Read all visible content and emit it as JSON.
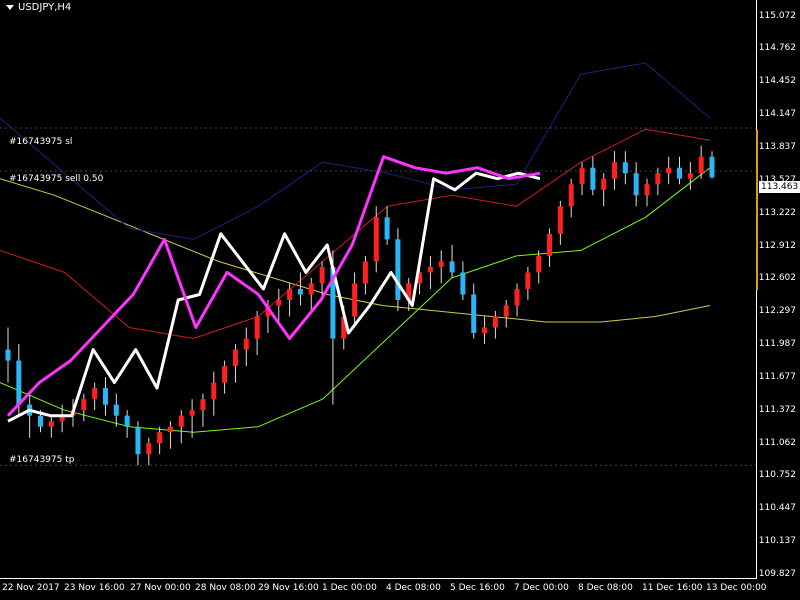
{
  "window": {
    "title": "USDJPY,H4",
    "menu_icon": "triangle-down-icon"
  },
  "orders": [
    {
      "label": "#16743975 sl",
      "price": 113.91
    },
    {
      "label": "#16743975 sell 0.50",
      "price": 113.52
    },
    {
      "label": "#16743975 tp",
      "price": 110.85
    }
  ],
  "current_price": {
    "label": "113.463",
    "value": 113.463
  },
  "price_axis": {
    "ticks": [
      "115.072",
      "114.762",
      "114.452",
      "114.147",
      "113.837",
      "113.527",
      "113.222",
      "112.912",
      "112.602",
      "112.297",
      "111.987",
      "111.677",
      "111.372",
      "111.062",
      "110.752",
      "110.447",
      "110.137",
      "109.827"
    ]
  },
  "time_axis": {
    "ticks": [
      "22 Nov 2017",
      "23 Nov 16:00",
      "27 Nov 00:00",
      "28 Nov 08:00",
      "29 Nov 16:00",
      "1 Dec 00:00",
      "4 Dec 08:00",
      "5 Dec 16:00",
      "7 Dec 00:00",
      "8 Dec 08:00",
      "11 Dec 16:00",
      "13 Dec 00:00"
    ]
  },
  "colors": {
    "bull": "#ff2020",
    "bear": "#29b6f6",
    "white_line": "#ffffff",
    "magenta_line": "#ff33ff",
    "ma_yellow": "#d4c84a",
    "ma_green": "#7cfc00",
    "band_red": "#c81e1e",
    "band_navy": "#1a237e",
    "cloud": "#3355ff"
  },
  "chart_data": {
    "type": "candlestick",
    "symbol": "USDJPY",
    "timeframe": "H4",
    "ylim": [
      109.827,
      115.072
    ],
    "candles": [
      [
        111.9,
        112.1,
        111.6,
        111.8
      ],
      [
        111.8,
        111.95,
        111.3,
        111.4
      ],
      [
        111.4,
        111.5,
        111.1,
        111.3
      ],
      [
        111.3,
        111.35,
        111.15,
        111.2
      ],
      [
        111.2,
        111.3,
        111.1,
        111.25
      ],
      [
        111.25,
        111.4,
        111.15,
        111.3
      ],
      [
        111.3,
        111.45,
        111.2,
        111.35
      ],
      [
        111.35,
        111.5,
        111.25,
        111.45
      ],
      [
        111.45,
        111.6,
        111.35,
        111.55
      ],
      [
        111.55,
        111.65,
        111.3,
        111.4
      ],
      [
        111.4,
        111.5,
        111.2,
        111.3
      ],
      [
        111.3,
        111.35,
        111.1,
        111.2
      ],
      [
        111.2,
        111.25,
        110.85,
        110.95
      ],
      [
        110.95,
        111.1,
        110.85,
        111.05
      ],
      [
        111.05,
        111.2,
        110.95,
        111.15
      ],
      [
        111.15,
        111.25,
        111.0,
        111.2
      ],
      [
        111.2,
        111.35,
        111.05,
        111.3
      ],
      [
        111.3,
        111.45,
        111.1,
        111.35
      ],
      [
        111.35,
        111.5,
        111.2,
        111.45
      ],
      [
        111.45,
        111.7,
        111.3,
        111.6
      ],
      [
        111.6,
        111.8,
        111.5,
        111.75
      ],
      [
        111.75,
        111.95,
        111.6,
        111.9
      ],
      [
        111.9,
        112.1,
        111.75,
        112.0
      ],
      [
        112.0,
        112.25,
        111.85,
        112.2
      ],
      [
        112.2,
        112.35,
        112.05,
        112.3
      ],
      [
        112.3,
        112.45,
        112.15,
        112.35
      ],
      [
        112.35,
        112.5,
        112.2,
        112.45
      ],
      [
        112.45,
        112.6,
        112.3,
        112.4
      ],
      [
        112.4,
        112.55,
        112.25,
        112.5
      ],
      [
        112.5,
        112.7,
        112.35,
        112.65
      ],
      [
        112.65,
        112.8,
        111.4,
        112.0
      ],
      [
        112.0,
        112.3,
        111.9,
        112.2
      ],
      [
        112.2,
        112.6,
        112.1,
        112.5
      ],
      [
        112.5,
        112.75,
        112.4,
        112.7
      ],
      [
        112.7,
        113.2,
        112.6,
        113.1
      ],
      [
        113.1,
        113.2,
        112.85,
        112.9
      ],
      [
        112.9,
        113.0,
        112.25,
        112.35
      ],
      [
        112.35,
        112.55,
        112.25,
        112.5
      ],
      [
        112.5,
        112.7,
        112.4,
        112.6
      ],
      [
        112.6,
        112.75,
        112.45,
        112.65
      ],
      [
        112.65,
        112.8,
        112.5,
        112.7
      ],
      [
        112.7,
        112.85,
        112.55,
        112.6
      ],
      [
        112.6,
        112.7,
        112.35,
        112.4
      ],
      [
        112.4,
        112.5,
        112.0,
        112.05
      ],
      [
        112.05,
        112.2,
        111.95,
        112.1
      ],
      [
        112.1,
        112.25,
        112.0,
        112.2
      ],
      [
        112.2,
        112.35,
        112.1,
        112.3
      ],
      [
        112.3,
        112.5,
        112.2,
        112.45
      ],
      [
        112.45,
        112.65,
        112.35,
        112.6
      ],
      [
        112.6,
        112.8,
        112.5,
        112.75
      ],
      [
        112.75,
        113.0,
        112.65,
        112.95
      ],
      [
        112.95,
        113.25,
        112.85,
        113.2
      ],
      [
        113.2,
        113.45,
        113.1,
        113.4
      ],
      [
        113.4,
        113.6,
        113.3,
        113.55
      ],
      [
        113.55,
        113.65,
        113.3,
        113.35
      ],
      [
        113.35,
        113.5,
        113.2,
        113.45
      ],
      [
        113.45,
        113.7,
        113.35,
        113.6
      ],
      [
        113.6,
        113.7,
        113.4,
        113.5
      ],
      [
        113.5,
        113.6,
        113.2,
        113.3
      ],
      [
        113.3,
        113.45,
        113.2,
        113.4
      ],
      [
        113.4,
        113.55,
        113.3,
        113.5
      ],
      [
        113.5,
        113.65,
        113.4,
        113.55
      ],
      [
        113.55,
        113.65,
        113.4,
        113.45
      ],
      [
        113.45,
        113.6,
        113.35,
        113.5
      ],
      [
        113.5,
        113.75,
        113.45,
        113.65
      ],
      [
        113.65,
        113.7,
        113.45,
        113.463
      ]
    ],
    "series": [
      {
        "color": "#ffffff",
        "y": [
          111.25,
          111.35,
          111.3,
          111.3,
          111.9,
          111.6,
          111.9,
          111.55,
          112.35,
          112.4,
          112.95,
          112.7,
          112.45,
          112.95,
          112.6,
          112.85,
          112.05,
          112.3,
          112.6,
          112.3,
          113.45,
          113.35,
          113.5,
          113.45,
          113.5,
          113.45
        ]
      },
      {
        "color": "#ff33ff",
        "y": [
          111.3,
          111.6,
          111.8,
          112.1,
          112.4,
          112.9,
          112.1,
          112.6,
          112.4,
          112.0,
          112.35,
          112.85,
          113.65,
          113.55,
          113.5,
          113.55,
          113.45,
          113.5
        ]
      },
      {
        "color": "#d4c84a",
        "y": [
          113.45,
          113.3,
          113.1,
          112.9,
          112.7,
          112.55,
          112.4,
          112.3,
          112.25,
          112.2,
          112.15,
          112.15,
          112.2,
          112.3
        ]
      },
      {
        "color": "#7cfc00",
        "y": [
          111.6,
          111.35,
          111.2,
          111.15,
          111.2,
          111.45,
          112.0,
          112.55,
          112.75,
          112.8,
          113.1,
          113.55
        ]
      },
      {
        "color": "#c81e1e",
        "y": [
          112.8,
          112.6,
          112.1,
          112.0,
          112.2,
          112.7,
          113.2,
          113.3,
          113.2,
          113.6,
          113.9,
          113.8
        ]
      },
      {
        "color": "#1a237e",
        "y": [
          114.0,
          113.5,
          113.0,
          112.9,
          113.2,
          113.6,
          113.5,
          113.35,
          113.4,
          114.4,
          114.5,
          114.0
        ]
      }
    ]
  }
}
